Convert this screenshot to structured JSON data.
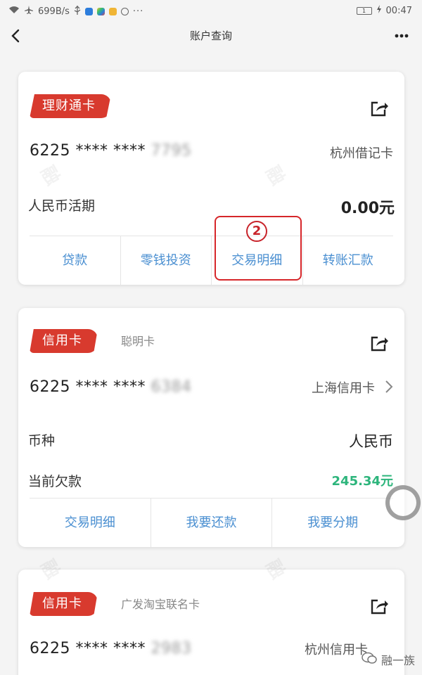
{
  "status": {
    "speed": "699B/s",
    "battery": "1",
    "time": "00:47"
  },
  "nav": {
    "title": "账户查询"
  },
  "card1": {
    "badge": "理财通卡",
    "number_prefix": "6225 **** ****",
    "number_suffix": "7795",
    "card_type": "杭州借记卡",
    "balance_label": "人民币活期",
    "balance_value": "0.00元",
    "actions": [
      "贷款",
      "零钱投资",
      "交易明细",
      "转账汇款"
    ],
    "annotation_number": "2"
  },
  "card2": {
    "badge": "信用卡",
    "subtitle": "聪明卡",
    "number_prefix": "6225 **** ****",
    "number_suffix": "6384",
    "card_type": "上海信用卡",
    "currency_label": "币种",
    "currency_value": "人民币",
    "owed_label": "当前欠款",
    "owed_value": "245.34元",
    "actions": [
      "交易明细",
      "我要还款",
      "我要分期"
    ]
  },
  "card3": {
    "badge": "信用卡",
    "subtitle": "广发淘宝联名卡",
    "number_prefix": "6225 **** ****",
    "number_suffix": "2983",
    "card_type": "杭州信用卡"
  },
  "watermark": {
    "brand": "融一族",
    "char1": "融",
    "char2": "一",
    "char3": "族"
  },
  "colors": {
    "badge_red": "#d83a2e",
    "action_blue": "#4a8fd1",
    "amount_green": "#2db57c",
    "annotation_red": "#d6262a"
  }
}
